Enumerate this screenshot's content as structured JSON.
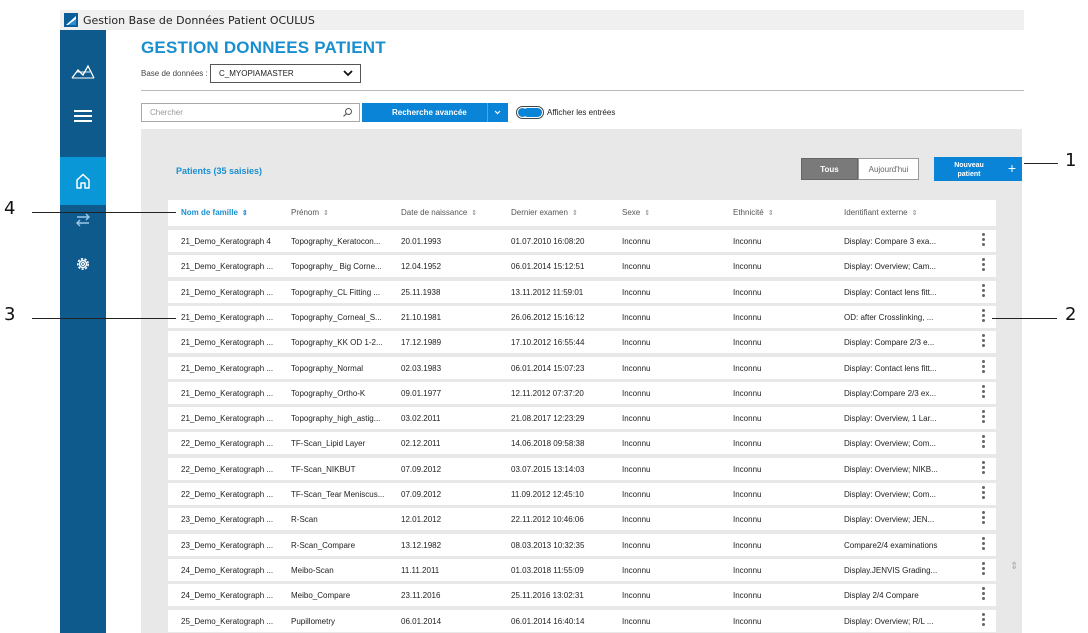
{
  "window": {
    "title": "Gestion Base de Données Patient OCULUS"
  },
  "page": {
    "heading": "GESTION DONNEES PATIENT"
  },
  "database": {
    "label": "Base de données :",
    "selected": "C_MYOPIAMASTER"
  },
  "search": {
    "placeholder": "Chercher",
    "advanced_label": "Recherche avancée",
    "toggle_label": "Afficher les entrées",
    "toggle_on": true
  },
  "patients": {
    "count_label": "Patients (35 saisies)"
  },
  "filters": {
    "all_label": "Tous",
    "today_label": "Aujourd'hui",
    "active": "Tous"
  },
  "new_patient": {
    "label": "Nouveau patient",
    "plus": "+"
  },
  "table": {
    "columns": [
      "Nom de famille",
      "Prénom",
      "Date de naissance",
      "Dernier examen",
      "Sexe",
      "Ethnicité",
      "Identifiant externe"
    ],
    "rows": [
      [
        "21_Demo_Keratograph 4",
        "Topography_Keratocon...",
        "20.01.1993",
        "01.07.2010 16:08:20",
        "Inconnu",
        "Inconnu",
        "Display: Compare 3 exa..."
      ],
      [
        "21_Demo_Keratograph ...",
        "Topography_ Big Corne...",
        "12.04.1952",
        "06.01.2014 15:12:51",
        "Inconnu",
        "Inconnu",
        "Display: Overview; Cam..."
      ],
      [
        "21_Demo_Keratograph ...",
        "Topography_CL Fitting ...",
        "25.11.1938",
        "13.11.2012 11:59:01",
        "Inconnu",
        "Inconnu",
        "Display: Contact lens fitt..."
      ],
      [
        "21_Demo_Keratograph ...",
        "Topography_Corneal_S...",
        "21.10.1981",
        "26.06.2012 15:16:12",
        "Inconnu",
        "Inconnu",
        "OD: after Crosslinking, ..."
      ],
      [
        "21_Demo_Keratograph ...",
        "Topography_KK OD 1-2...",
        "17.12.1989",
        "17.10.2012 16:55:44",
        "Inconnu",
        "Inconnu",
        "Display: Compare 2/3 e..."
      ],
      [
        "21_Demo_Keratograph ...",
        "Topography_Normal",
        "02.03.1983",
        "06.01.2014 15:07:23",
        "Inconnu",
        "Inconnu",
        "Display: Contact lens fitt..."
      ],
      [
        "21_Demo_Keratograph ...",
        "Topography_Ortho-K",
        "09.01.1977",
        "12.11.2012 07:37:20",
        "Inconnu",
        "Inconnu",
        "Display:Compare 2/3 ex..."
      ],
      [
        "21_Demo_Keratograph ...",
        "Topography_high_astig...",
        "03.02.2011",
        "21.08.2017 12:23:29",
        "Inconnu",
        "Inconnu",
        "Display: Overview, 1 Lar..."
      ],
      [
        "22_Demo_Keratograph ...",
        "TF-Scan_Lipid Layer",
        "02.12.2011",
        "14.06.2018 09:58:38",
        "Inconnu",
        "Inconnu",
        "Display: Overview; Com..."
      ],
      [
        "22_Demo_Keratograph ...",
        "TF-Scan_NIKBUT",
        "07.09.2012",
        "03.07.2015 13:14:03",
        "Inconnu",
        "Inconnu",
        "Display: Overview; NIKB..."
      ],
      [
        "22_Demo_Keratograph ...",
        "TF-Scan_Tear Meniscus...",
        "07.09.2012",
        "11.09.2012 12:45:10",
        "Inconnu",
        "Inconnu",
        "Display: Overview; Com..."
      ],
      [
        "23_Demo_Keratograph ...",
        "R-Scan",
        "12.01.2012",
        "22.11.2012 10:46:06",
        "Inconnu",
        "Inconnu",
        "Display: Overview; JEN..."
      ],
      [
        "23_Demo_Keratograph ...",
        "R-Scan_Compare",
        "13.12.1982",
        "08.03.2013 10:32:35",
        "Inconnu",
        "Inconnu",
        "Compare2/4 examinations"
      ],
      [
        "24_Demo_Keratograph ...",
        "Meibo-Scan",
        "11.11.2011",
        "01.03.2018 11:55:09",
        "Inconnu",
        "Inconnu",
        "Display.JENVIS Grading..."
      ],
      [
        "24_Demo_Keratograph ...",
        "Meibo_Compare",
        "23.11.2016",
        "25.11.2016 13:02:31",
        "Inconnu",
        "Inconnu",
        "Display 2/4 Compare"
      ],
      [
        "25_Demo_Keratograph ...",
        "Pupillometry",
        "06.01.2014",
        "06.01.2014 16:40:14",
        "Inconnu",
        "Inconnu",
        "Display: Overview; R/L ..."
      ]
    ]
  },
  "callouts": [
    "1",
    "2",
    "3",
    "4"
  ],
  "colors": {
    "accent": "#0a84d6",
    "heading": "#1a8fd0",
    "sidebar": "#0f5a8c",
    "sidebar_active": "#0a97d8"
  },
  "icons": {
    "app": "oculus-app-icon",
    "logo": "oculus-logo-icon",
    "menu": "hamburger-menu-icon",
    "home": "home-icon",
    "swap": "swap-arrows-icon",
    "settings": "gear-icon",
    "search": "search-icon",
    "row_menu": "kebab-menu-icon"
  }
}
